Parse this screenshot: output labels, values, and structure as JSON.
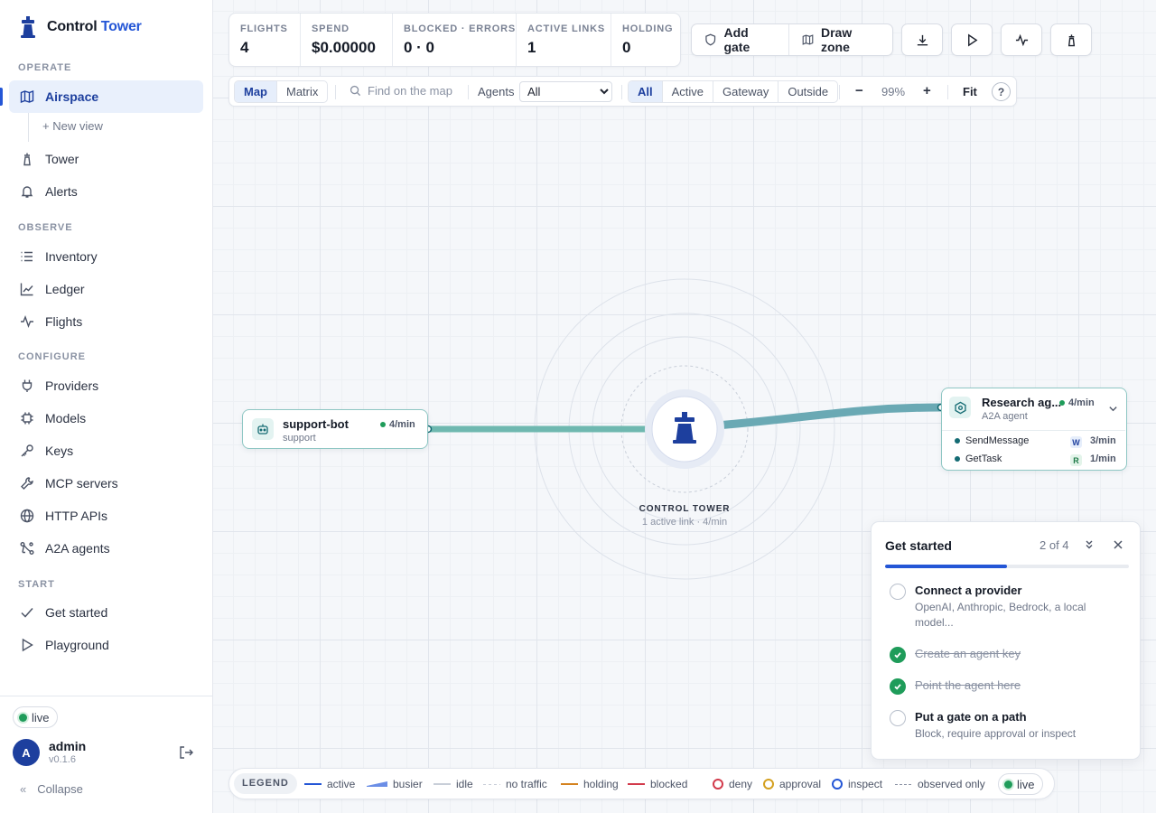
{
  "brand": {
    "name_main": "Control",
    "name_accent": "Tower"
  },
  "sidebar": {
    "sections": {
      "operate": "OPERATE",
      "observe": "OBSERVE",
      "configure": "CONFIGURE",
      "start": "START"
    },
    "operate": [
      {
        "label": "Airspace",
        "icon": "map-icon",
        "active": true
      },
      {
        "label": "Tower",
        "icon": "tower-icon"
      },
      {
        "label": "Alerts",
        "icon": "bell-icon"
      }
    ],
    "new_view": "+ New view",
    "observe": [
      {
        "label": "Inventory",
        "icon": "list-icon"
      },
      {
        "label": "Ledger",
        "icon": "chart-line-icon"
      },
      {
        "label": "Flights",
        "icon": "pulse-icon"
      }
    ],
    "configure": [
      {
        "label": "Providers",
        "icon": "plug-icon"
      },
      {
        "label": "Models",
        "icon": "chip-icon"
      },
      {
        "label": "Keys",
        "icon": "key-icon"
      },
      {
        "label": "MCP servers",
        "icon": "wrench-icon"
      },
      {
        "label": "HTTP APIs",
        "icon": "globe-icon"
      },
      {
        "label": "A2A agents",
        "icon": "network-icon"
      }
    ],
    "start": [
      {
        "label": "Get started",
        "icon": "check-icon"
      },
      {
        "label": "Playground",
        "icon": "play-icon"
      }
    ],
    "status": "live",
    "user": {
      "initial": "A",
      "name": "admin",
      "version": "v0.1.6"
    },
    "collapse": "Collapse"
  },
  "stats": [
    {
      "label": "FLIGHTS",
      "value": "4"
    },
    {
      "label": "SPEND",
      "value": "$0.00000"
    },
    {
      "label": "BLOCKED · ERRORS",
      "value": "0 · 0"
    },
    {
      "label": "ACTIVE LINKS",
      "value": "1"
    },
    {
      "label": "HOLDING",
      "value": "0"
    }
  ],
  "actions": {
    "add_gate": "Add gate",
    "draw_zone": "Draw zone"
  },
  "toolbar": {
    "view_modes": [
      "Map",
      "Matrix"
    ],
    "selected_view": "Map",
    "search_placeholder": "Find on the map",
    "agents_label": "Agents",
    "agents_value": "All",
    "filters": [
      "All",
      "Active",
      "Gateway",
      "Outside"
    ],
    "selected_filter": "All",
    "zoom_minus": "−",
    "zoom": "99%",
    "zoom_plus": "+",
    "fit": "Fit",
    "help": "?"
  },
  "map": {
    "left_node": {
      "title": "support-bot",
      "subtitle": "support",
      "rate": "4/min"
    },
    "right_node": {
      "title": "Research ag...",
      "subtitle": "A2A agent",
      "rate": "4/min",
      "methods": [
        {
          "name": "SendMessage",
          "badge": "W",
          "rate": "3/min"
        },
        {
          "name": "GetTask",
          "badge": "R",
          "rate": "1/min"
        }
      ]
    },
    "tower": {
      "label": "CONTROL TOWER",
      "subtitle": "1 active link · 4/min"
    }
  },
  "get_started": {
    "title": "Get started",
    "progress_text": "2 of 4",
    "progress_fraction": 0.5,
    "steps": [
      {
        "title": "Connect a provider",
        "desc": "OpenAI, Anthropic, Bedrock, a local model...",
        "done": false
      },
      {
        "title": "Create an agent key",
        "desc": "",
        "done": true
      },
      {
        "title": "Point the agent here",
        "desc": "",
        "done": true
      },
      {
        "title": "Put a gate on a path",
        "desc": "Block, require approval or inspect",
        "done": false
      }
    ]
  },
  "legend": {
    "title": "LEGEND",
    "items": [
      "active",
      "busier",
      "idle",
      "no traffic",
      "holding",
      "blocked",
      "deny",
      "approval",
      "inspect",
      "observed only"
    ],
    "live": "live"
  },
  "colors": {
    "accent": "#2456d6",
    "link": "#6aa9b4",
    "live": "#1f9c5a",
    "holding": "#d4821f",
    "blocked": "#d23a4b"
  }
}
